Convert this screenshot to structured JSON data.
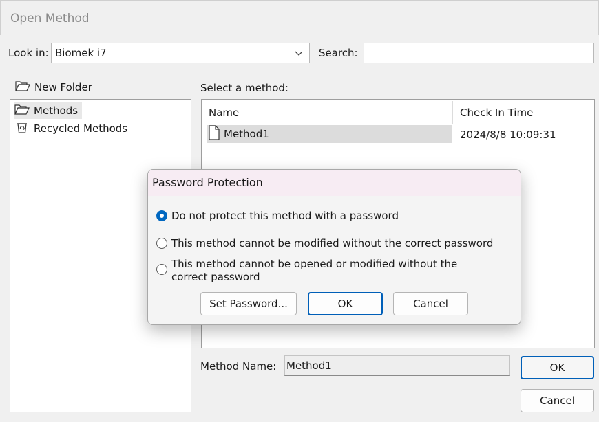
{
  "window": {
    "title": "Open Method"
  },
  "toolbar": {
    "look_in_label": "Look in:",
    "look_in_value": "Biomek i7",
    "search_label": "Search:",
    "search_value": ""
  },
  "sidebar": {
    "new_folder_label": "New Folder",
    "items": [
      {
        "label": "Methods",
        "icon": "open-folder-icon",
        "selected": true
      },
      {
        "label": "Recycled Methods",
        "icon": "recycle-bin-icon",
        "selected": false
      }
    ]
  },
  "method_list": {
    "caption": "Select a method:",
    "columns": [
      "Name",
      "Check In Time"
    ],
    "rows": [
      {
        "name": "Method1",
        "check_in_time": "2024/8/8 10:09:31",
        "icon": "document-icon",
        "selected": true
      }
    ]
  },
  "footer": {
    "method_name_label": "Method Name:",
    "method_name_value": "Method1",
    "ok_label": "OK",
    "cancel_label": "Cancel"
  },
  "dialog": {
    "title": "Password Protection",
    "options": [
      {
        "label": "Do not protect this method with a password",
        "checked": true
      },
      {
        "label": "This method cannot be modified without the correct password",
        "checked": false
      },
      {
        "label": "This method cannot be opened or modified without the correct password",
        "checked": false
      }
    ],
    "set_password_label": "Set Password...",
    "ok_label": "OK",
    "cancel_label": "Cancel"
  },
  "colors": {
    "accent": "#0067c0",
    "focus_border": "#005fb8",
    "dialog_titlebar": "#f7ecf3"
  }
}
